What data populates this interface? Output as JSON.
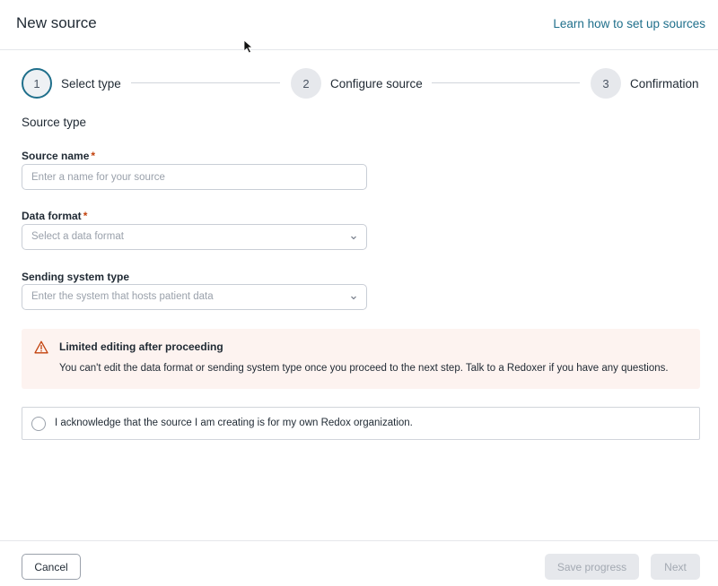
{
  "header": {
    "title": "New source",
    "help_link": "Learn how to set up sources"
  },
  "stepper": {
    "steps": [
      {
        "number": "1",
        "label": "Select type",
        "state": "active"
      },
      {
        "number": "2",
        "label": "Configure source",
        "state": "pending"
      },
      {
        "number": "3",
        "label": "Confirmation",
        "state": "pending"
      }
    ]
  },
  "form": {
    "section_title": "Source type",
    "source_name": {
      "label": "Source name",
      "required_mark": "*",
      "value": "",
      "placeholder": "Enter a name for your source"
    },
    "data_format": {
      "label": "Data format",
      "required_mark": "*",
      "placeholder": "Select a data format"
    },
    "sending_system": {
      "label": "Sending system type",
      "placeholder": "Enter the system that hosts patient data"
    }
  },
  "warning": {
    "icon": "warning-triangle-icon",
    "title": "Limited editing after proceeding",
    "body": "You can't edit the data format or sending system type once you proceed to the next step. Talk to a Redoxer if you have any questions."
  },
  "acknowledge": {
    "checked": false,
    "text": "I acknowledge that the source I am creating is for my own Redox organization."
  },
  "footer": {
    "cancel_label": "Cancel",
    "save_label": "Save progress",
    "next_label": "Next"
  },
  "colors": {
    "accent": "#1f6f8b",
    "required": "#c2410c",
    "warning_bg": "#fdf3f0",
    "warning_icon": "#c2410c",
    "disabled_bg": "#e6e8ec"
  }
}
